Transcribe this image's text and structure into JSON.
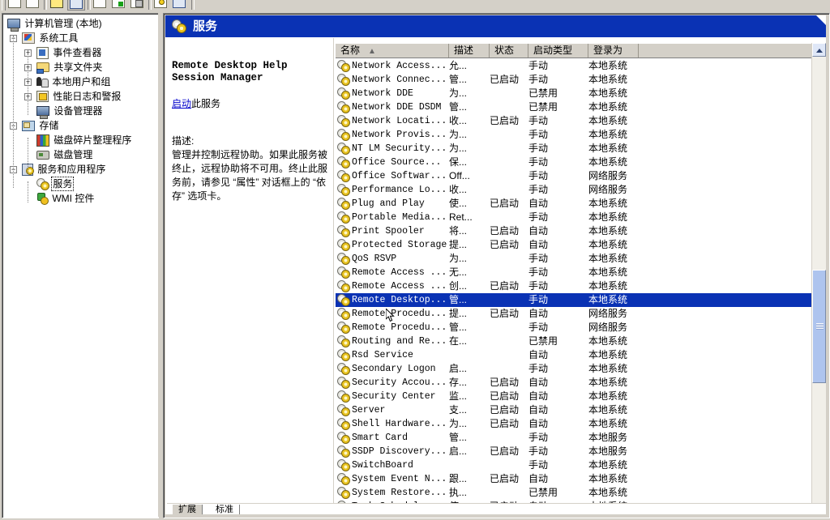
{
  "window": {
    "title": "计算机管理 (本地)"
  },
  "toolbar": {
    "buttons": [
      {
        "name": "back-button",
        "icon": "back-arrow-icon"
      },
      {
        "name": "forward-button",
        "icon": "forward-arrow-icon"
      },
      {
        "name": "up-button",
        "icon": "up-folder-icon"
      },
      {
        "name": "show-tree-button",
        "icon": "console-tree-icon"
      },
      {
        "name": "properties-button",
        "icon": "properties-icon"
      },
      {
        "name": "refresh-button",
        "icon": "refresh-icon"
      },
      {
        "name": "export-list-button",
        "icon": "export-list-icon"
      },
      {
        "name": "help-button",
        "icon": "help-icon"
      },
      {
        "name": "new-window-button",
        "icon": "new-window-icon"
      }
    ]
  },
  "tree": {
    "root": {
      "label": "计算机管理 (本地)",
      "icon": "computer-icon"
    },
    "nodes": [
      {
        "label": "系统工具",
        "icon": "system-tools-icon",
        "expander": "-",
        "depth": 1
      },
      {
        "label": "事件查看器",
        "icon": "event-viewer-icon",
        "expander": "+",
        "depth": 2
      },
      {
        "label": "共享文件夹",
        "icon": "shared-folders-icon",
        "expander": "+",
        "depth": 2
      },
      {
        "label": "本地用户和组",
        "icon": "local-users-groups-icon",
        "expander": "+",
        "depth": 2
      },
      {
        "label": "性能日志和警报",
        "icon": "performance-logs-icon",
        "expander": "+",
        "depth": 2
      },
      {
        "label": "设备管理器",
        "icon": "device-manager-icon",
        "expander": "",
        "depth": 2
      },
      {
        "label": "存储",
        "icon": "storage-icon",
        "expander": "-",
        "depth": 1
      },
      {
        "label": "磁盘碎片整理程序",
        "icon": "disk-defragmenter-icon",
        "expander": "",
        "depth": 2
      },
      {
        "label": "磁盘管理",
        "icon": "disk-management-icon",
        "expander": "",
        "depth": 2
      },
      {
        "label": "服务和应用程序",
        "icon": "services-applications-icon",
        "expander": "-",
        "depth": 1
      },
      {
        "label": "服务",
        "icon": "services-icon",
        "expander": "",
        "depth": 2,
        "selected": true
      },
      {
        "label": "WMI 控件",
        "icon": "wmi-control-icon",
        "expander": "",
        "depth": 2
      }
    ]
  },
  "banner": {
    "title": "服务",
    "icon": "services-gear-icon"
  },
  "description_pane": {
    "service_name": "Remote Desktop Help Session Manager",
    "action_link": "启动",
    "action_suffix": "此服务",
    "description_label": "描述:",
    "description_text": "管理并控制远程协助。如果此服务被终止，远程协助将不可用。终止此服务前，请参见 “属性” 对话框上的 “依存” 选项卡。"
  },
  "list": {
    "columns": [
      {
        "label": "名称",
        "sort": "▲"
      },
      {
        "label": "描述"
      },
      {
        "label": "状态"
      },
      {
        "label": "启动类型"
      },
      {
        "label": "登录为"
      }
    ],
    "rows": [
      {
        "name": "Network Access...",
        "desc": "允...",
        "status": "",
        "startup": "手动",
        "logon": "本地系统"
      },
      {
        "name": "Network Connec...",
        "desc": "管...",
        "status": "已启动",
        "startup": "手动",
        "logon": "本地系统"
      },
      {
        "name": "Network DDE",
        "desc": "为...",
        "status": "",
        "startup": "已禁用",
        "logon": "本地系统"
      },
      {
        "name": "Network DDE DSDM",
        "desc": "管...",
        "status": "",
        "startup": "已禁用",
        "logon": "本地系统"
      },
      {
        "name": "Network Locati...",
        "desc": "收...",
        "status": "已启动",
        "startup": "手动",
        "logon": "本地系统"
      },
      {
        "name": "Network Provis...",
        "desc": "为...",
        "status": "",
        "startup": "手动",
        "logon": "本地系统"
      },
      {
        "name": "NT LM Security...",
        "desc": "为...",
        "status": "",
        "startup": "手动",
        "logon": "本地系统"
      },
      {
        "name": "Office  Source...",
        "desc": "保...",
        "status": "",
        "startup": "手动",
        "logon": "本地系统"
      },
      {
        "name": "Office Softwar...",
        "desc": "Off...",
        "status": "",
        "startup": "手动",
        "logon": "网络服务"
      },
      {
        "name": "Performance Lo...",
        "desc": "收...",
        "status": "",
        "startup": "手动",
        "logon": "网络服务"
      },
      {
        "name": "Plug and Play",
        "desc": "使...",
        "status": "已启动",
        "startup": "自动",
        "logon": "本地系统"
      },
      {
        "name": "Portable Media...",
        "desc": "Ret...",
        "status": "",
        "startup": "手动",
        "logon": "本地系统"
      },
      {
        "name": "Print Spooler",
        "desc": "将...",
        "status": "已启动",
        "startup": "自动",
        "logon": "本地系统"
      },
      {
        "name": "Protected Storage",
        "desc": "提...",
        "status": "已启动",
        "startup": "自动",
        "logon": "本地系统"
      },
      {
        "name": "QoS RSVP",
        "desc": "为...",
        "status": "",
        "startup": "手动",
        "logon": "本地系统"
      },
      {
        "name": "Remote Access ...",
        "desc": "无...",
        "status": "",
        "startup": "手动",
        "logon": "本地系统"
      },
      {
        "name": "Remote Access ...",
        "desc": "创...",
        "status": "已启动",
        "startup": "手动",
        "logon": "本地系统"
      },
      {
        "name": "Remote Desktop...",
        "desc": "管...",
        "status": "",
        "startup": "手动",
        "logon": "本地系统",
        "selected": true
      },
      {
        "name": "Remote Procedu...",
        "desc": "提...",
        "status": "已启动",
        "startup": "自动",
        "logon": "网络服务"
      },
      {
        "name": "Remote Procedu...",
        "desc": "管...",
        "status": "",
        "startup": "手动",
        "logon": "网络服务"
      },
      {
        "name": "Routing and Re...",
        "desc": "在...",
        "status": "",
        "startup": "已禁用",
        "logon": "本地系统"
      },
      {
        "name": "Rsd Service",
        "desc": "",
        "status": "",
        "startup": "自动",
        "logon": "本地系统"
      },
      {
        "name": "Secondary Logon",
        "desc": "启...",
        "status": "",
        "startup": "手动",
        "logon": "本地系统"
      },
      {
        "name": "Security Accou...",
        "desc": "存...",
        "status": "已启动",
        "startup": "自动",
        "logon": "本地系统"
      },
      {
        "name": "Security Center",
        "desc": "监...",
        "status": "已启动",
        "startup": "自动",
        "logon": "本地系统"
      },
      {
        "name": "Server",
        "desc": "支...",
        "status": "已启动",
        "startup": "自动",
        "logon": "本地系统"
      },
      {
        "name": "Shell Hardware...",
        "desc": "为...",
        "status": "已启动",
        "startup": "自动",
        "logon": "本地系统"
      },
      {
        "name": "Smart Card",
        "desc": "管...",
        "status": "",
        "startup": "手动",
        "logon": "本地服务"
      },
      {
        "name": "SSDP Discovery...",
        "desc": "启...",
        "status": "已启动",
        "startup": "手动",
        "logon": "本地服务"
      },
      {
        "name": "SwitchBoard",
        "desc": "",
        "status": "",
        "startup": "手动",
        "logon": "本地系统"
      },
      {
        "name": "System Event N...",
        "desc": "跟...",
        "status": "已启动",
        "startup": "自动",
        "logon": "本地系统"
      },
      {
        "name": "System Restore...",
        "desc": "执...",
        "status": "",
        "startup": "已禁用",
        "logon": "本地系统"
      },
      {
        "name": "Task Scheduler",
        "desc": "使...",
        "status": "已启动",
        "startup": "自动",
        "logon": "本地系统"
      }
    ]
  },
  "tabs": [
    {
      "label": "扩展",
      "active": false
    },
    {
      "label": "标准",
      "active": true
    }
  ],
  "colors": {
    "selection": "#0a32b4",
    "banner": "#0a32b4",
    "link": "#0000cc",
    "chrome": "#d4d0c8"
  }
}
